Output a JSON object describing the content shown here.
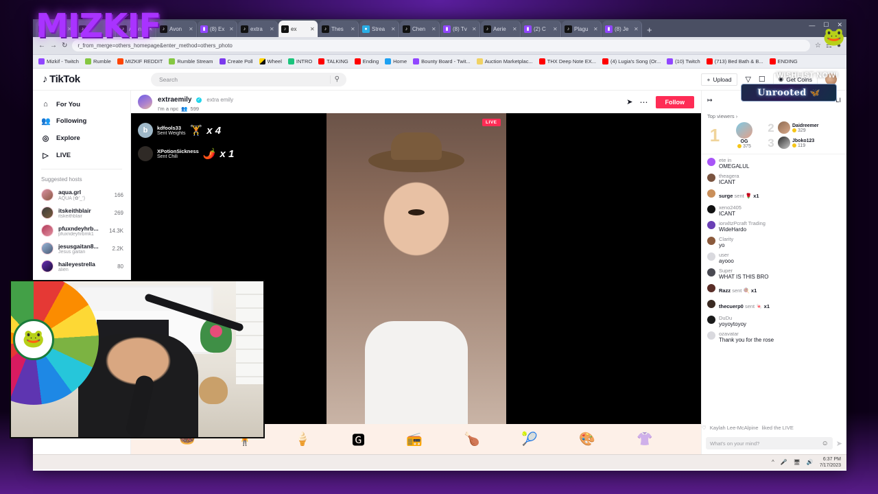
{
  "watermark": {
    "text": "MIZKIF"
  },
  "browser": {
    "tabs": [
      {
        "favicon": "tiktok-icon",
        "label": ""
      },
      {
        "favicon": "tiktok-icon",
        "label": ""
      },
      {
        "favicon": "tiktok-icon",
        "label": "Avon"
      },
      {
        "favicon": "tiktok-icon",
        "label": "Avon"
      },
      {
        "favicon": "twitch-icon",
        "label": "(8) Ex"
      },
      {
        "favicon": "tiktok-icon",
        "label": "extra"
      },
      {
        "favicon": "tiktok-icon",
        "label": "ex",
        "active": true
      },
      {
        "favicon": "tiktok-icon",
        "label": "Thes"
      },
      {
        "favicon": "stream-icon",
        "label": "Strea"
      },
      {
        "favicon": "tiktok-icon",
        "label": "Chen"
      },
      {
        "favicon": "twitch-icon",
        "label": "(8) Tv"
      },
      {
        "favicon": "tiktok-icon",
        "label": "Aerie"
      },
      {
        "favicon": "twitch-icon",
        "label": "(2) C"
      },
      {
        "favicon": "tiktok-icon",
        "label": "Plagu"
      },
      {
        "favicon": "twitch-icon",
        "label": "(8) Je"
      }
    ],
    "new_tab_label": "+",
    "window_buttons": {
      "minimize": "—",
      "maximize": "☐",
      "close": "✕"
    },
    "nav": {
      "back": "←",
      "forward": "→",
      "reload": "↻"
    },
    "omnibox_url": "r_from_merge=others_homepage&enter_method=others_photo",
    "bookmarks": [
      {
        "icon": "twitch-icon",
        "label": "Mizkif - Twitch"
      },
      {
        "icon": "rumble-icon",
        "label": "Rumble"
      },
      {
        "icon": "reddit-icon",
        "label": "MIZKIF REDDIT"
      },
      {
        "icon": "rumble-icon",
        "label": "Rumble Stream"
      },
      {
        "icon": "poll-icon",
        "label": "Create Poll"
      },
      {
        "icon": "wheel-icon",
        "label": "Wheel"
      },
      {
        "icon": "intro-icon",
        "label": "INTRO"
      },
      {
        "icon": "youtube-icon",
        "label": "TALKING"
      },
      {
        "icon": "youtube-icon",
        "label": "Ending"
      },
      {
        "icon": "twitter-icon",
        "label": "Home"
      },
      {
        "icon": "twitch-icon",
        "label": "Bounty Board - Twit..."
      },
      {
        "icon": "dot-icon",
        "label": "Auction Marketplac..."
      },
      {
        "icon": "youtube-icon",
        "label": "THX Deep Note EX..."
      },
      {
        "icon": "youtube-icon",
        "label": "(4) Lugia's Song (Or..."
      },
      {
        "icon": "twitch-icon",
        "label": "(10) Twitch"
      },
      {
        "icon": "youtube-icon",
        "label": "(713) Bed Bath & B..."
      },
      {
        "icon": "youtube-icon",
        "label": "ENDING"
      }
    ]
  },
  "tiktok": {
    "logo": "TikTok",
    "search": {
      "placeholder": "Search",
      "icon": "search-icon"
    },
    "upload_label": "Upload",
    "get_coins_label": "Get Coins",
    "header_icons": [
      "inbox-icon",
      "message-icon"
    ],
    "sidebar": {
      "items": [
        {
          "icon": "home-icon",
          "label": "For You"
        },
        {
          "icon": "people-icon",
          "label": "Following"
        },
        {
          "icon": "compass-icon",
          "label": "Explore"
        },
        {
          "icon": "live-icon",
          "label": "LIVE"
        }
      ],
      "suggested_title": "Suggested hosts",
      "hosts": [
        {
          "name": "aqua.grl",
          "handle": "AQUA (✿’_’)",
          "count": "166"
        },
        {
          "name": "itskeithblair",
          "handle": "itskeithblair",
          "count": "269"
        },
        {
          "name": "pfuxndeyhrb...",
          "handle": "pfuxndeyhrbmk1",
          "count": "14.3K"
        },
        {
          "name": "jesusgaitan8...",
          "handle": "Jesus gaitan",
          "count": "2.2K"
        },
        {
          "name": "haileyestrella",
          "handle": "alien",
          "count": "80"
        }
      ]
    },
    "stream": {
      "username": "extraemily",
      "verified": true,
      "display_name": "extra emily",
      "title": "I'm a npc",
      "viewers": "599",
      "viewers_icon": "viewers-icon",
      "share_icon": "share-icon",
      "more_icon": "more-icon",
      "follow_label": "Follow",
      "live_badge": "LIVE",
      "gift_toasts": [
        {
          "initial": "b",
          "user": "kdfools33",
          "action": "Sent Weights",
          "emoji": "🏋️",
          "qty": "x 4"
        },
        {
          "initial": "",
          "user": "XPotionSickness",
          "action": "Sent Chili",
          "emoji": "🌶️",
          "qty": "x 1"
        }
      ],
      "gift_tray": [
        "🍩",
        "🧍",
        "🍦",
        "🅶",
        "📻",
        "🍗",
        "🎾",
        "🎨",
        "👚"
      ]
    },
    "chat": {
      "expand_icon": "expand-icon",
      "tab_label": "LI",
      "top_viewers_label": "Top viewers",
      "top_viewers": [
        {
          "rank": "1",
          "name": "OG",
          "coins": "375"
        },
        {
          "rank": "2",
          "name": "Daidreemer",
          "coins": "329"
        },
        {
          "rank": "3",
          "name": "Jboko123",
          "coins": "119"
        }
      ],
      "messages": [
        {
          "user": "ete in",
          "text": "OMEGALUL"
        },
        {
          "user": "theagera",
          "text": "ICANT"
        },
        {
          "user": "surge",
          "inline": "sent",
          "emoji": "🌹",
          "qty": "x1"
        },
        {
          "user": "xeno2405",
          "text": "ICANT"
        },
        {
          "user": "ionxltzPcraft Trading",
          "text": "WideHardo"
        },
        {
          "user": "Clarity",
          "text": "yo"
        },
        {
          "user": "user",
          "text": "ayooo"
        },
        {
          "user": "Super",
          "text": "WHAT IS THIS BRO"
        },
        {
          "user": "Razz",
          "inline": "sent",
          "emoji": "🍭",
          "qty": "x1"
        },
        {
          "user": "thecuerp0",
          "inline": "sent",
          "emoji": "🍬",
          "qty": "x1"
        },
        {
          "user": "DuDu",
          "text": "yoyoytoyoy"
        },
        {
          "user": "ozavatar",
          "text": "Thank you for the rose"
        }
      ],
      "liked_notice": {
        "icon": "heart-icon",
        "user": "Kaylah Lee-McAlpine",
        "text": "liked the LIVE"
      },
      "input_placeholder": "What's on your mind?",
      "emoji_icon": "emoji-icon",
      "send_icon": "send-icon"
    }
  },
  "overlay": {
    "unrooted_label": "Unrooted",
    "wishlist_label": "WISHLIST NOW!",
    "frog_icon": "frog-icon"
  },
  "taskbar": {
    "chevron_icon": "chevron-up-icon",
    "mic_icon": "mic-icon",
    "network_icon": "network-icon",
    "volume_icon": "volume-icon",
    "time": "6:37 PM",
    "date": "7/17/2023"
  }
}
